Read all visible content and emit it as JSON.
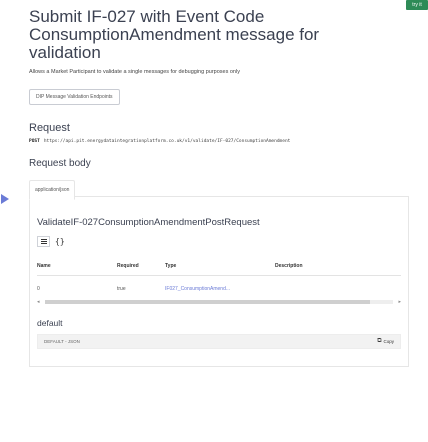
{
  "try_button": "try it",
  "operation": {
    "title": "Submit IF-027 with Event Code ConsumptionAmendment message for validation",
    "summary": "Allows a Market Participant to validate a single messages for debugging purposes only",
    "tag": "DIP Message Validation Endpoints"
  },
  "request": {
    "heading": "Request",
    "method": "POST",
    "url": "https://api.pit.energydataintegrationplatform.co.uk/v1/validate/IF-027/ConsumptionAmendment"
  },
  "request_body": {
    "heading": "Request body",
    "media_tab": "application/json",
    "schema_name": "ValidateIF-027ConsumptionAmendmentPostRequest",
    "brace_glyph": "{}",
    "columns": [
      "Name",
      "Required",
      "Type",
      "Description"
    ],
    "rows": [
      {
        "name": "0",
        "required": "true",
        "type": "IF027_ConsumptionAmend...",
        "description": ""
      }
    ]
  },
  "default_example": {
    "heading": "default",
    "label": "DEFAULT - JSON",
    "copy_label": "Copy"
  },
  "icons": {
    "play_arrow": "play-arrow-icon",
    "table_view": "table-icon",
    "copy": "copy-icon"
  },
  "colors": {
    "try_button": "#2e8b57",
    "arrow": "#6b7bd6",
    "type_link": "#6b7bd6"
  }
}
